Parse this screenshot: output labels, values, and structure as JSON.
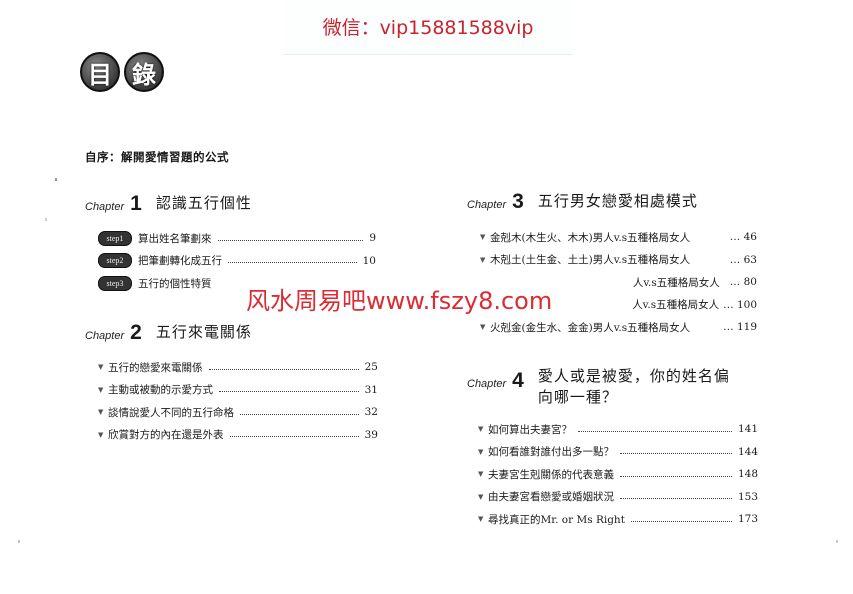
{
  "banner": {
    "text": "微信：vip15881588vip"
  },
  "logo": {
    "chars": [
      "目",
      "錄"
    ]
  },
  "preface": "自序：解開愛情習題的公式",
  "chapter_word": "Chapter",
  "chapters": [
    {
      "number": "1",
      "title": "認識五行個性",
      "entries": [
        {
          "badge": "step1",
          "text": "算出姓名筆劃來",
          "page": "9"
        },
        {
          "badge": "step2",
          "text": "把筆劃轉化成五行",
          "page": "10"
        },
        {
          "badge": "step3",
          "text": "五行的個性特質",
          "page": ""
        }
      ]
    },
    {
      "number": "2",
      "title": "五行來電關係",
      "entries": [
        {
          "text": "五行的戀愛來電關係",
          "page": "25"
        },
        {
          "text": "主動或被動的示愛方式",
          "page": "31"
        },
        {
          "text": "談情說愛人不同的五行命格",
          "page": "32"
        },
        {
          "text": "欣賞對方的內在還是外表",
          "page": "39"
        }
      ]
    },
    {
      "number": "3",
      "title": "五行男女戀愛相處模式",
      "entries": [
        {
          "text": "金剋木(木生火、木木)男人v.s五種格局女人",
          "page": "46"
        },
        {
          "text": "木剋土(土生金、土土)男人v.s五種格局女人",
          "page": "63"
        },
        {
          "text": "人v.s五種格局女人",
          "page": "80"
        },
        {
          "text": "人v.s五種格局女人",
          "page": "100"
        },
        {
          "text": "火剋金(金生水、金金)男人v.s五種格局女人",
          "page": "119"
        }
      ]
    },
    {
      "number": "4",
      "title_lines": [
        "愛人或是被愛，你的姓名偏",
        "向哪一種？"
      ],
      "entries": [
        {
          "text": "如何算出夫妻宮？",
          "page": "141"
        },
        {
          "text": "如何看誰對誰付出多一點？",
          "page": "144"
        },
        {
          "text": "夫妻宮生剋關係的代表意義",
          "page": "148"
        },
        {
          "text": "由夫妻宮看戀愛或婚姻狀況",
          "page": "153"
        },
        {
          "text": "尋找真正的Mr. or Ms Right",
          "page": "173"
        }
      ]
    }
  ],
  "watermark": "风水周易吧www.fszy8.com",
  "colors": {
    "watermark": "#dd2b33",
    "banner_text": "#c8232c"
  }
}
